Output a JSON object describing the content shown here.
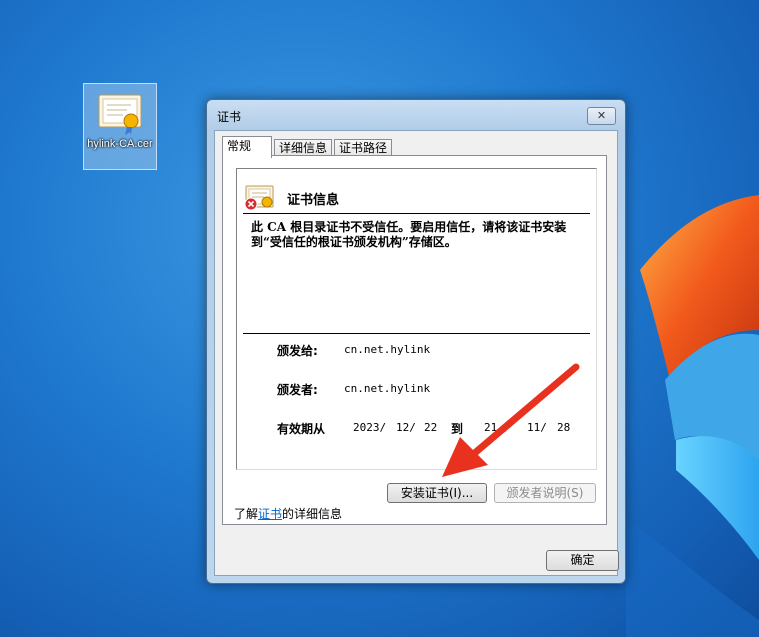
{
  "desktop": {
    "icon_label": "hylink-CA.cer"
  },
  "dialog": {
    "title": "证书",
    "close_label": "✕",
    "tabs": [
      {
        "label": "常规"
      },
      {
        "label": "详细信息"
      },
      {
        "label": "证书路径"
      }
    ],
    "info_title": "证书信息",
    "warning_text": "此 CA 根目录证书不受信任。要启用信任，请将该证书安装到“受信任的根证书颁发机构”存储区。",
    "issued_to_label": "颁发给:",
    "issued_to_value": "cn.net.hylink",
    "issued_by_label": "颁发者:",
    "issued_by_value": "cn.net.hylink",
    "valid_from_label": "有效期从",
    "valid_from": {
      "year": "2023/",
      "month": "12/",
      "day": "22"
    },
    "valid_to_label": "到",
    "valid_to": {
      "year": "21  /",
      "month": "11/",
      "day": "28"
    },
    "install_button": "安装证书(I)...",
    "issuer_statement_button": "颁发者说明(S)",
    "learn_more_prefix": "了解",
    "learn_more_link": "证书",
    "learn_more_suffix": "的详细信息",
    "ok_button": "确定"
  },
  "colors": {
    "annotation_arrow": "#e8321f"
  }
}
